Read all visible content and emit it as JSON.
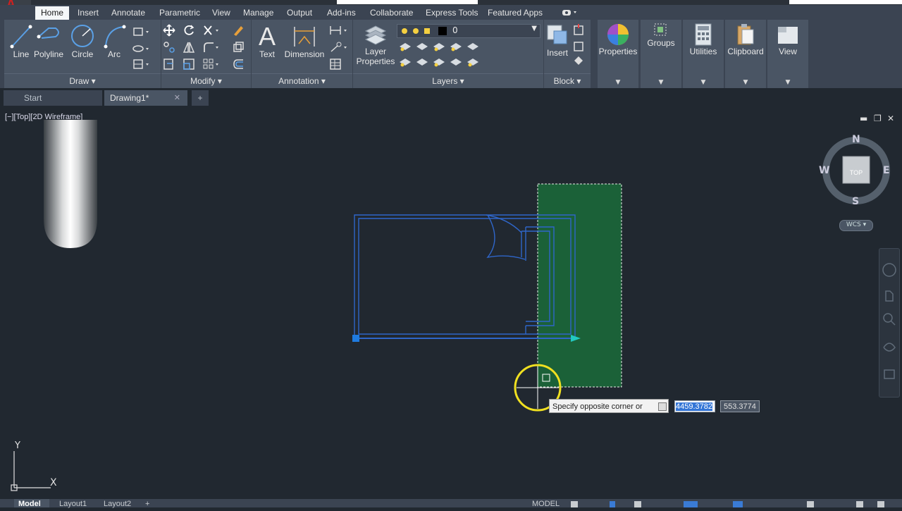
{
  "app": {
    "logo_letter": "A"
  },
  "ribbon_tabs": [
    "Home",
    "Insert",
    "Annotate",
    "Parametric",
    "View",
    "Manage",
    "Output",
    "Add-ins",
    "Collaborate",
    "Express Tools",
    "Featured Apps"
  ],
  "draw_panel": {
    "title": "Draw",
    "tools": [
      "Line",
      "Polyline",
      "Circle",
      "Arc"
    ]
  },
  "modify_panel": {
    "title": "Modify"
  },
  "annotation_panel": {
    "title": "Annotation",
    "tools": [
      "Text",
      "Dimension"
    ]
  },
  "layers_panel": {
    "title": "Layers",
    "tool": "Layer Properties",
    "current_layer": "0"
  },
  "block_panel": {
    "title": "Block",
    "tool": "Insert"
  },
  "extra_tools": [
    "Properties",
    "Groups",
    "Utilities",
    "Clipboard",
    "View"
  ],
  "doc_tabs": [
    {
      "label": "Start"
    },
    {
      "label": "Drawing1*"
    }
  ],
  "viewport": {
    "label": "[−][Top][2D Wireframe]"
  },
  "viewcube": {
    "top": "TOP",
    "n": "N",
    "s": "S",
    "e": "E",
    "w": "W",
    "wcs": "WCS"
  },
  "ucs": {
    "x": "X",
    "y": "Y"
  },
  "prompt": {
    "text": "Specify opposite corner or",
    "x_value": "4459.3782",
    "y_value": "553.3774"
  },
  "layout_tabs": [
    "Model",
    "Layout1",
    "Layout2"
  ],
  "status": {
    "model_label": "MODEL"
  },
  "colors": {
    "selection_fill": "#1a6b3a",
    "geometry": "#2f66c9",
    "background": "#212830"
  }
}
